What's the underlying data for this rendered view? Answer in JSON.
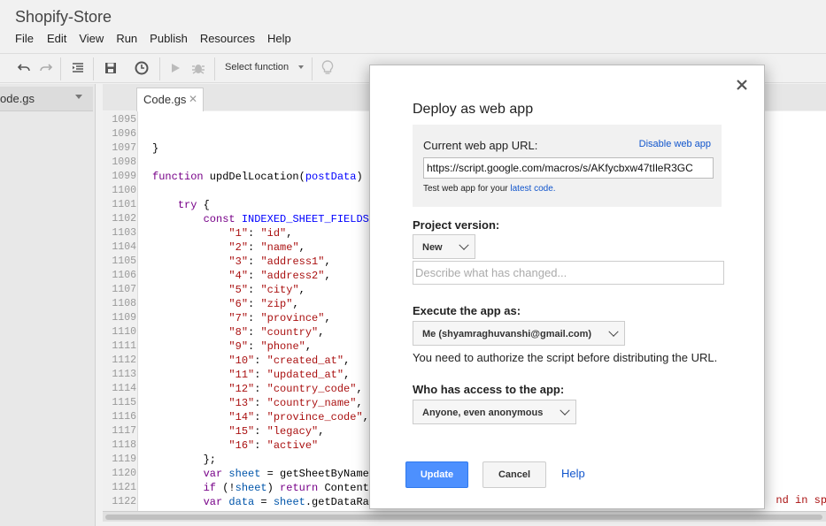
{
  "app": {
    "title": "Shopify-Store"
  },
  "menu": [
    "File",
    "Edit",
    "View",
    "Run",
    "Publish",
    "Resources",
    "Help"
  ],
  "toolbar": {
    "select_function_label": "Select function"
  },
  "sidebar": {
    "file_label": "ode.gs"
  },
  "editor": {
    "tab_label": "Code.gs",
    "lines": [
      {
        "n": "1095",
        "t": ""
      },
      {
        "n": "1096",
        "t": ""
      },
      {
        "n": "1097",
        "t": "}"
      },
      {
        "n": "1098",
        "t": ""
      },
      {
        "n": "1099",
        "t": "function updDelLocation(postData)"
      },
      {
        "n": "1100",
        "t": ""
      },
      {
        "n": "1101",
        "t": "    try {"
      },
      {
        "n": "1102",
        "t": "        const INDEXED_SHEET_FIELDS"
      },
      {
        "n": "1103",
        "t": "            \"1\": \"id\","
      },
      {
        "n": "1104",
        "t": "            \"2\": \"name\","
      },
      {
        "n": "1105",
        "t": "            \"3\": \"address1\","
      },
      {
        "n": "1106",
        "t": "            \"4\": \"address2\","
      },
      {
        "n": "1107",
        "t": "            \"5\": \"city\","
      },
      {
        "n": "1108",
        "t": "            \"6\": \"zip\","
      },
      {
        "n": "1109",
        "t": "            \"7\": \"province\","
      },
      {
        "n": "1110",
        "t": "            \"8\": \"country\","
      },
      {
        "n": "1111",
        "t": "            \"9\": \"phone\","
      },
      {
        "n": "1112",
        "t": "            \"10\": \"created_at\","
      },
      {
        "n": "1113",
        "t": "            \"11\": \"updated_at\","
      },
      {
        "n": "1114",
        "t": "            \"12\": \"country_code\","
      },
      {
        "n": "1115",
        "t": "            \"13\": \"country_name\","
      },
      {
        "n": "1116",
        "t": "            \"14\": \"province_code\","
      },
      {
        "n": "1117",
        "t": "            \"15\": \"legacy\","
      },
      {
        "n": "1118",
        "t": "            \"16\": \"active\""
      },
      {
        "n": "1119",
        "t": "        };"
      },
      {
        "n": "1120",
        "t": "        var sheet = getSheetByName"
      },
      {
        "n": "1121",
        "t": "        if (!sheet) return Content"
      },
      {
        "n": "1122",
        "t": "        var data = sheet.getDataRa"
      }
    ],
    "overflow_text": "nd in spre"
  },
  "dialog": {
    "title": "Deploy as web app",
    "current_url_label": "Current web app URL:",
    "disable_link": "Disable web app",
    "url_value": "https://script.google.com/macros/s/AKfycbxw47tIleR3GC",
    "test_prefix": "Test web app for your ",
    "test_link": "latest code.",
    "project_version_label": "Project version:",
    "version_value": "New",
    "describe_placeholder": "Describe what has changed...",
    "execute_label": "Execute the app as:",
    "execute_value": "Me (shyamraghuvanshi@gmail.com)",
    "authorize_note": "You need to authorize the script before distributing the URL.",
    "access_label": "Who has access to the app:",
    "access_value": "Anyone, even anonymous",
    "update_button": "Update",
    "cancel_button": "Cancel",
    "help_link": "Help"
  }
}
